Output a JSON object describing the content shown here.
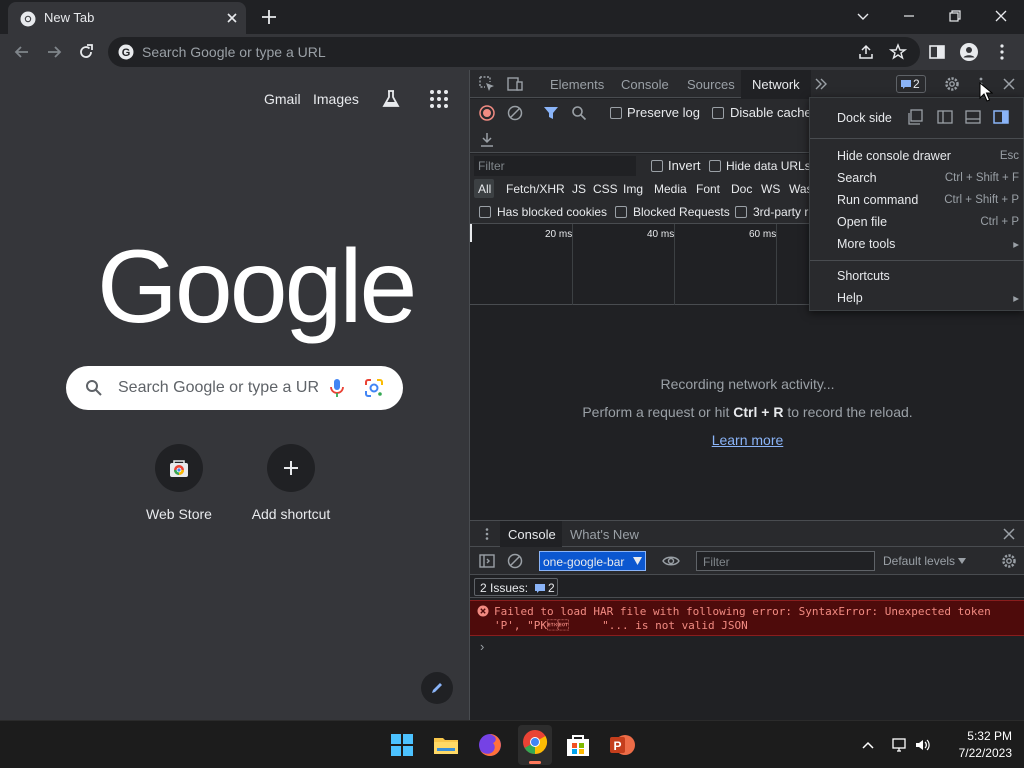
{
  "browser": {
    "tab_title": "New Tab",
    "omnibox_placeholder": "Search Google or type a URL"
  },
  "ntp": {
    "gmail": "Gmail",
    "images": "Images",
    "logo": "Google",
    "search_placeholder": "Search Google or type a URL",
    "shortcuts": [
      {
        "label": "Web Store"
      },
      {
        "label": "Add shortcut"
      }
    ]
  },
  "devtools": {
    "tabs": [
      "Elements",
      "Console",
      "Sources",
      "Network"
    ],
    "active_tab": "Network",
    "issues_count": "2",
    "network": {
      "preserve_log": "Preserve log",
      "disable_cache": "Disable cache",
      "filter_placeholder": "Filter",
      "invert": "Invert",
      "hide_data_urls": "Hide data URLs",
      "types": [
        "All",
        "Fetch/XHR",
        "JS",
        "CSS",
        "Img",
        "Media",
        "Font",
        "Doc",
        "WS",
        "Was"
      ],
      "has_blocked_cookies": "Has blocked cookies",
      "blocked_requests": "Blocked Requests",
      "third_party": "3rd-party r",
      "ticks": [
        "20 ms",
        "40 ms",
        "60 ms"
      ],
      "empty_line1": "Recording network activity...",
      "empty_line2_pre": "Perform a request or hit ",
      "empty_line2_keys": "Ctrl + R",
      "empty_line2_post": " to record the reload.",
      "learn_more": "Learn more"
    },
    "drawer": {
      "tabs": [
        "Console",
        "What's New"
      ],
      "context": "one-google-bar",
      "filter_placeholder": "Filter",
      "levels": "Default levels",
      "issues_label": "2 Issues:",
      "issues_count": "2",
      "error_line1": "Failed to load HAR file with following error: SyntaxError: Unexpected token",
      "error_line2": "'P', \"PK\u0003\u0004     \"... is not valid JSON",
      "prompt": "›"
    },
    "menu": {
      "dock_side": "Dock side",
      "items": [
        {
          "label": "Hide console drawer",
          "shortcut": "Esc"
        },
        {
          "label": "Search",
          "shortcut": "Ctrl + Shift + F"
        },
        {
          "label": "Run command",
          "shortcut": "Ctrl + Shift + P"
        },
        {
          "label": "Open file",
          "shortcut": "Ctrl + P"
        },
        {
          "label": "More tools",
          "shortcut": "▸"
        }
      ],
      "items2": [
        {
          "label": "Shortcuts",
          "shortcut": ""
        },
        {
          "label": "Help",
          "shortcut": "▸"
        }
      ]
    }
  },
  "taskbar": {
    "time": "5:32 PM",
    "date": "7/22/2023"
  },
  "colors": {
    "accent": "#8ab4f8",
    "error_bg": "#4e0b0b",
    "error_text": "#f28b82"
  }
}
